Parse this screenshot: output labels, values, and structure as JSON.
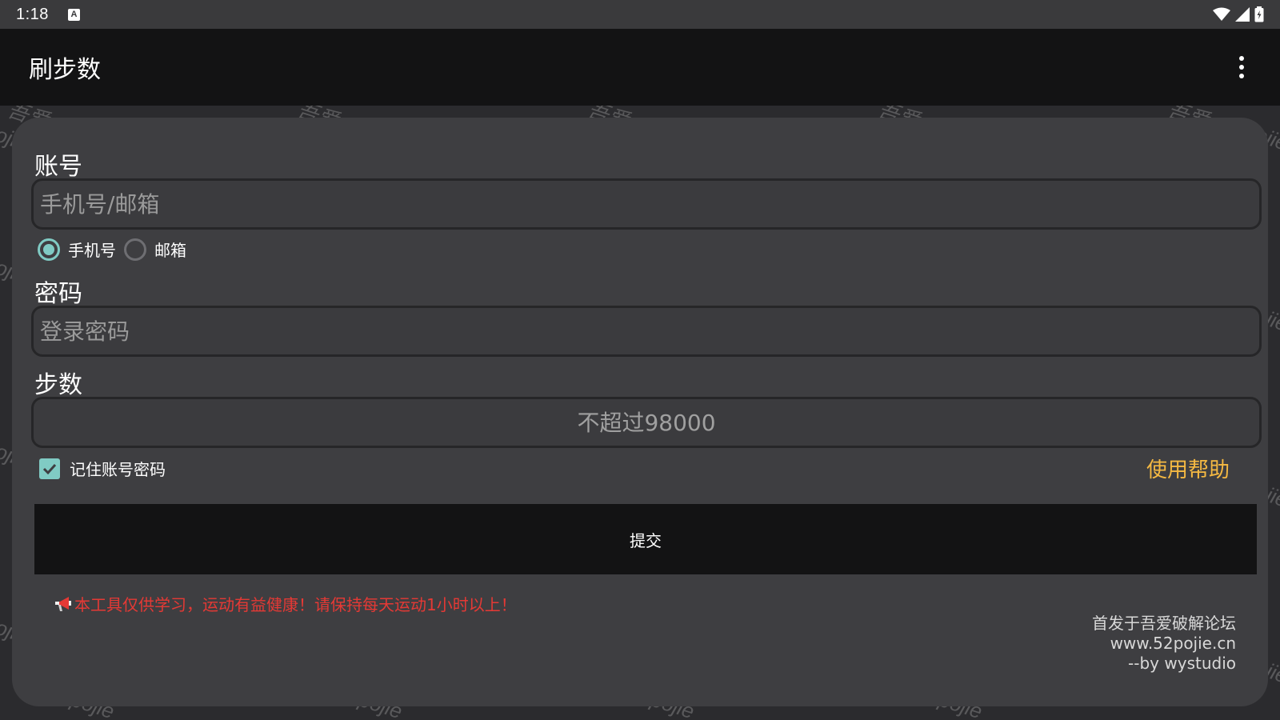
{
  "status_bar": {
    "time": "1:18",
    "notification_icon": "a-icon",
    "right_icons": [
      "wifi-icon",
      "cell-signal-icon",
      "battery-icon"
    ]
  },
  "app_bar": {
    "title": "刷步数",
    "menu_icon": "more-vert-icon"
  },
  "watermark": {
    "texts": [
      "吾爱",
      "pojie",
      "52pojie"
    ]
  },
  "form": {
    "account": {
      "label": "账号",
      "placeholder": "手机号/邮箱",
      "value": ""
    },
    "account_type": {
      "options": [
        {
          "label": "手机号",
          "selected": true
        },
        {
          "label": "邮箱",
          "selected": false
        }
      ]
    },
    "password": {
      "label": "密码",
      "placeholder": "登录密码",
      "value": ""
    },
    "steps": {
      "label": "步数",
      "placeholder": "不超过98000",
      "value": ""
    },
    "remember": {
      "label": "记住账号密码",
      "checked": true
    },
    "help_link": "使用帮助",
    "submit_label": "提交"
  },
  "notice": {
    "icon": "megaphone-icon",
    "text": "本工具仅供学习，运动有益健康！请保持每天运动1小时以上！"
  },
  "credits": {
    "line1": "首发于吾爱破解论坛",
    "line2": "www.52pojie.cn",
    "line3": "--by wystudio"
  },
  "colors": {
    "accent": "#80cbc4",
    "help_link": "#f5b942",
    "notice": "#e53935",
    "card_bg": "#3e3e41",
    "app_bar_bg": "#131314"
  }
}
